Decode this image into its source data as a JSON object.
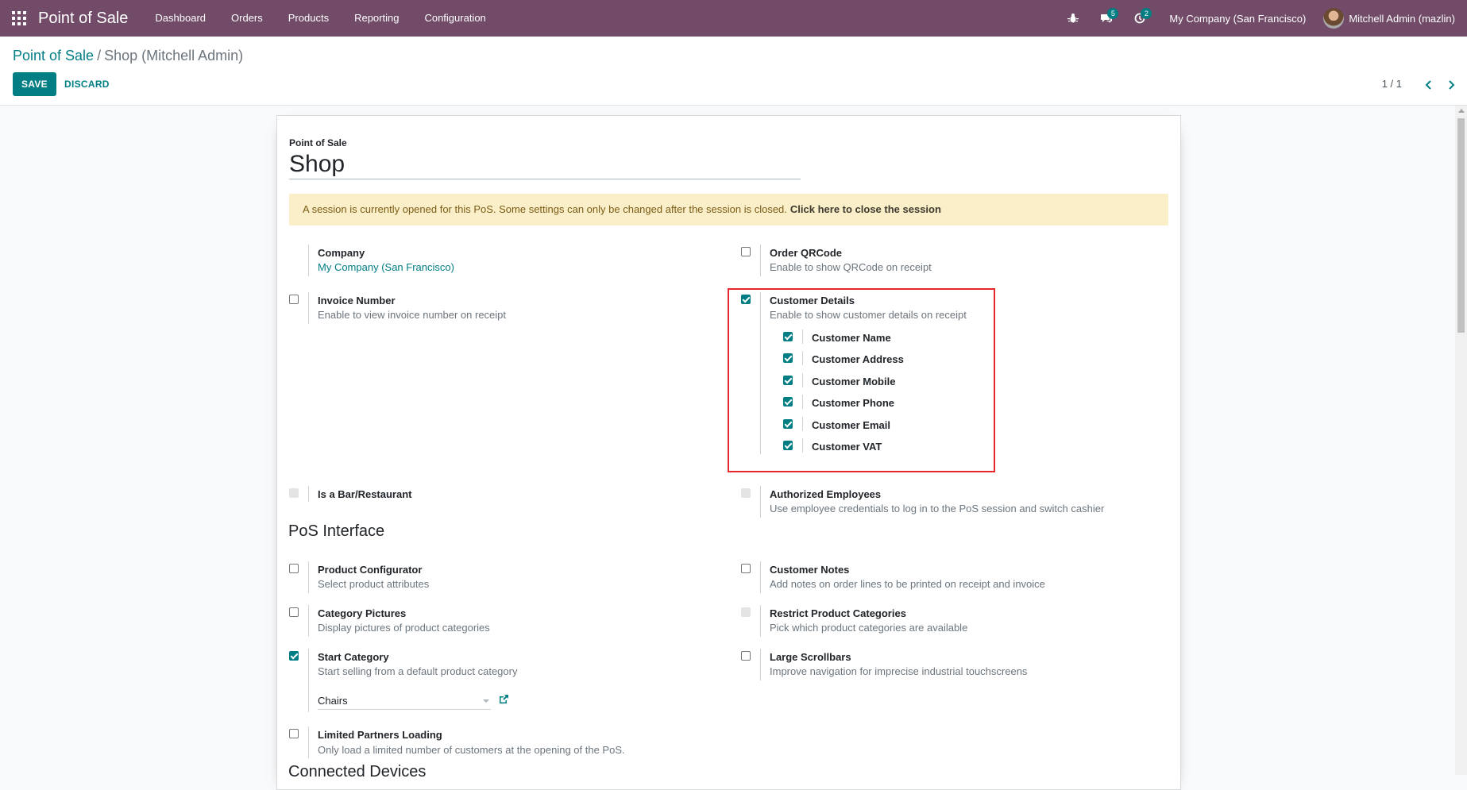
{
  "navbar": {
    "brand": "Point of Sale",
    "menu": [
      "Dashboard",
      "Orders",
      "Products",
      "Reporting",
      "Configuration"
    ],
    "messages_count": "5",
    "activities_count": "2",
    "company": "My Company (San Francisco)",
    "user": "Mitchell Admin (mazlin)",
    "colors": {
      "bar": "#714B67",
      "accent": "#017e84"
    }
  },
  "control_panel": {
    "breadcrumb_parent": "Point of Sale",
    "breadcrumb_separator": "/",
    "breadcrumb_current": "Shop (Mitchell Admin)",
    "save_label": "SAVE",
    "discard_label": "DISCARD",
    "pager": "1 / 1"
  },
  "form": {
    "name_label": "Point of Sale",
    "name_value": "Shop",
    "alert_text": "A session is currently opened for this PoS. Some settings can only be changed after the session is closed.",
    "alert_link": "Click here to close the session",
    "company": {
      "title": "Company",
      "value": "My Company (San Francisco)"
    },
    "order_qrcode": {
      "title": "Order QRCode",
      "desc": "Enable to show QRCode on receipt",
      "checked": false
    },
    "invoice_number": {
      "title": "Invoice Number",
      "desc": "Enable to view invoice number on receipt",
      "checked": false
    },
    "customer_details": {
      "title": "Customer Details",
      "desc": "Enable to show customer details on receipt",
      "checked": true,
      "sub": [
        {
          "label": "Customer Name",
          "checked": true
        },
        {
          "label": "Customer Address",
          "checked": true
        },
        {
          "label": "Customer Mobile",
          "checked": true
        },
        {
          "label": "Customer Phone",
          "checked": true
        },
        {
          "label": "Customer Email",
          "checked": true
        },
        {
          "label": "Customer VAT",
          "checked": true
        }
      ]
    },
    "is_bar": {
      "title": "Is a Bar/Restaurant",
      "disabled": true
    },
    "authorized_employees": {
      "title": "Authorized Employees",
      "desc": "Use employee credentials to log in to the PoS session and switch cashier",
      "disabled": true
    },
    "pos_interface_title": "PoS Interface",
    "product_configurator": {
      "title": "Product Configurator",
      "desc": "Select product attributes",
      "checked": false
    },
    "customer_notes": {
      "title": "Customer Notes",
      "desc": "Add notes on order lines to be printed on receipt and invoice",
      "checked": false
    },
    "category_pictures": {
      "title": "Category Pictures",
      "desc": "Display pictures of product categories",
      "checked": false
    },
    "restrict_categories": {
      "title": "Restrict Product Categories",
      "desc": "Pick which product categories are available",
      "disabled": true
    },
    "start_category": {
      "title": "Start Category",
      "desc": "Start selling from a default product category",
      "checked": true,
      "value": "Chairs"
    },
    "large_scrollbars": {
      "title": "Large Scrollbars",
      "desc": "Improve navigation for imprecise industrial touchscreens",
      "checked": false
    },
    "limited_partners": {
      "title": "Limited Partners Loading",
      "desc": "Only load a limited number of customers at the opening of the PoS.",
      "checked": false
    },
    "connected_devices_title": "Connected Devices"
  }
}
